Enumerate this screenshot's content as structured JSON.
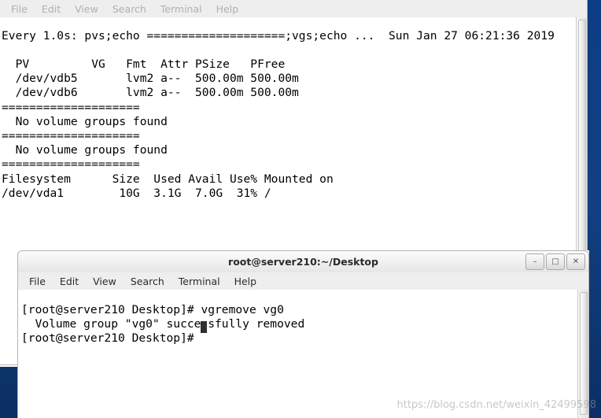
{
  "desktop": {
    "background_color": "#12448c",
    "watermark": "https://blog.csdn.net/weixin_42499598"
  },
  "window_background": {
    "title": "",
    "active": false,
    "menu": [
      "File",
      "Edit",
      "View",
      "Search",
      "Terminal",
      "Help"
    ],
    "window_buttons": {
      "minimize": "–",
      "maximize": "□",
      "close": "✕"
    },
    "terminal_lines": [
      "Every 1.0s: pvs;echo ====================;vgs;echo ...  Sun Jan 27 06:21:36 2019",
      "",
      "  PV         VG   Fmt  Attr PSize   PFree",
      "  /dev/vdb5       lvm2 a--  500.00m 500.00m",
      "  /dev/vdb6       lvm2 a--  500.00m 500.00m",
      "====================",
      "  No volume groups found",
      "====================",
      "  No volume groups found",
      "====================",
      "Filesystem      Size  Used Avail Use% Mounted on",
      "/dev/vda1        10G  3.1G  7.0G  31% /"
    ]
  },
  "window_foreground": {
    "title": "root@server210:~/Desktop",
    "active": true,
    "menu": [
      "File",
      "Edit",
      "View",
      "Search",
      "Terminal",
      "Help"
    ],
    "window_buttons": {
      "minimize": "–",
      "maximize": "□",
      "close": "✕"
    },
    "terminal_lines": [
      "[root@server210 Desktop]# vgremove vg0",
      "  Volume group \"vg0\" successfully removed",
      "[root@server210 Desktop]# "
    ]
  }
}
